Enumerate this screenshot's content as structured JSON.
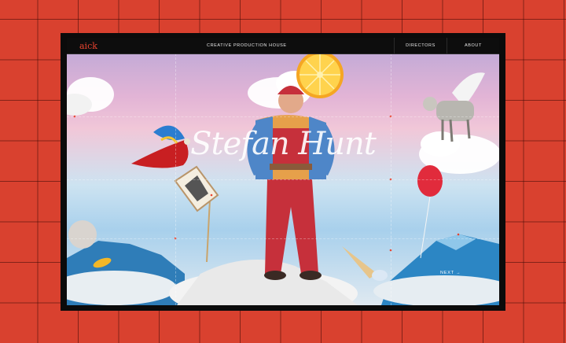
{
  "nav": {
    "logo": "aick",
    "tagline": "CREATIVE PRODUCTION HOUSE",
    "directors": "DIRECTORS",
    "about": "ABOUT"
  },
  "hero": {
    "title": "Stefan Hunt",
    "next_label": "NEXT"
  },
  "colors": {
    "background": "#d9412f",
    "frame": "#0b0b0b",
    "logo_accent": "#e8432f"
  }
}
